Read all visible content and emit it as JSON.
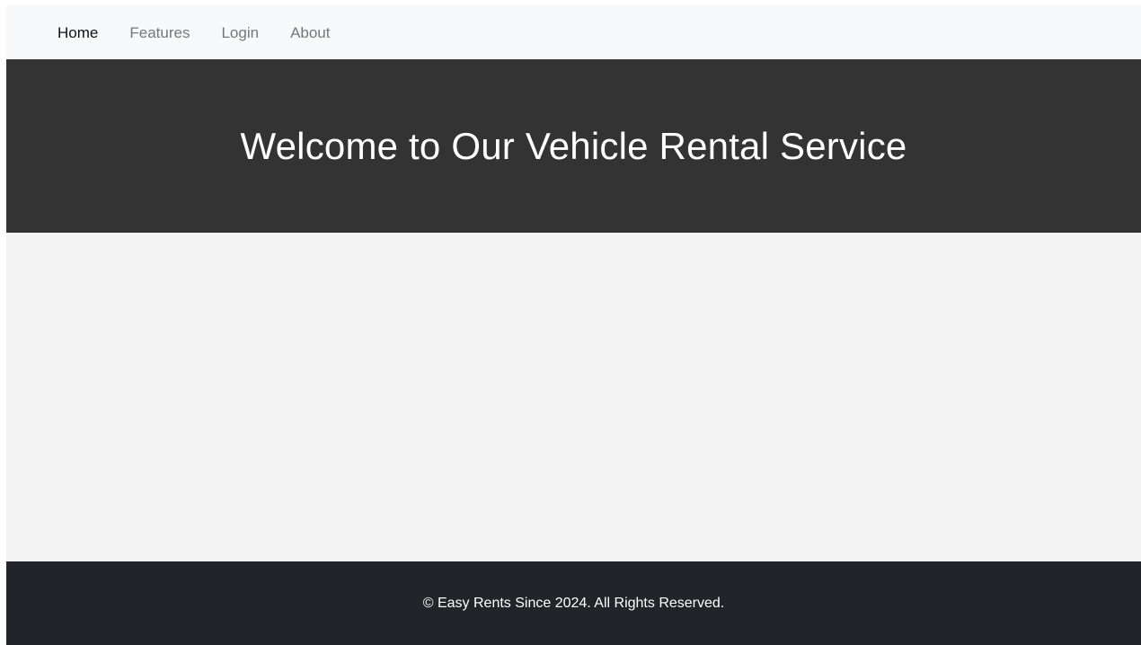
{
  "nav": {
    "items": [
      {
        "label": "Home",
        "active": true
      },
      {
        "label": "Features",
        "active": false
      },
      {
        "label": "Login",
        "active": false
      },
      {
        "label": "About",
        "active": false
      }
    ]
  },
  "hero": {
    "title": "Welcome to Our Vehicle Rental Service"
  },
  "footer": {
    "text": "© Easy Rents Since 2024. All Rights Reserved."
  },
  "colors": {
    "navbar_bg": "#f8f9fa",
    "hero_bg": "#333333",
    "main_bg": "#f3f3f3",
    "footer_bg": "#212529",
    "active_link": "#111111",
    "inactive_link": "#777777"
  }
}
